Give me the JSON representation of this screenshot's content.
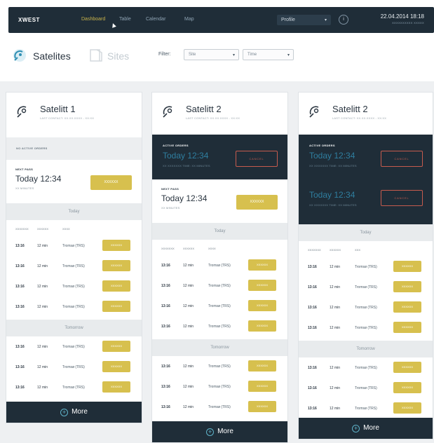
{
  "topbar": {
    "brand": "XWEST",
    "nav": [
      "Dashboard",
      "Table",
      "Calendar",
      "Map"
    ],
    "active_nav": "Dashboard",
    "profile_label": "Profile",
    "info_label": "i",
    "datetime": "22.04.2014 18:18",
    "datetime_sub": "XXXXXXXXXX XXXXX"
  },
  "header": {
    "satellites_label": "Satelites",
    "sites_label": "Sites",
    "filter_label": "Filter:",
    "filter_site": "Site",
    "filter_time": "Time"
  },
  "columns": [
    {
      "title": "Satelitt 1",
      "subtitle": "LAST CONTACT: XX.XX.XXXX - XX:XX",
      "no_orders_text": "NO ACTIVE ORDERS",
      "next_pass": {
        "label": "NEXT PASS",
        "time": "Today 12:34",
        "sub": "XX MINUTES",
        "button": "XXXXXX"
      },
      "sections": [
        {
          "name": "Today",
          "headers": [
            "XXXXXXX",
            "XXXXXX",
            "XXXX"
          ],
          "rows": [
            {
              "time": "13:16",
              "dur": "12 min",
              "site": "Tromsø (TRS)",
              "btn": "XXXXXX"
            },
            {
              "time": "13:16",
              "dur": "12 min",
              "site": "Tromsø (TRS)",
              "btn": "XXXXXX"
            },
            {
              "time": "13:16",
              "dur": "12 min",
              "site": "Tromsø (TRS)",
              "btn": "XXXXXX"
            },
            {
              "time": "13:16",
              "dur": "12 min",
              "site": "Tromsø (TRS)",
              "btn": "XXXXXX"
            }
          ]
        },
        {
          "name": "Tomorrow",
          "rows": [
            {
              "time": "13:16",
              "dur": "12 min",
              "site": "Tromsø (TRS)",
              "btn": "XXXXXX"
            },
            {
              "time": "13:16",
              "dur": "12 min",
              "site": "Tromsø (TRS)",
              "btn": "XXXXXX"
            },
            {
              "time": "13:16",
              "dur": "12 min",
              "site": "Tromsø (TRS)",
              "btn": "XXXXXX"
            }
          ]
        }
      ],
      "more": "More"
    },
    {
      "title": "Satelitt 2",
      "subtitle": "LAST CONTACT: XX.XX.XXXX - XX:XX",
      "active_orders": [
        {
          "label": "ACTIVE ORDERS",
          "time": "Today 12:34",
          "sub": "XX XXXXXXX TIME: XX MINUTES",
          "button": "CANCEL"
        }
      ],
      "next_pass": {
        "label": "NEXT PASS",
        "time": "Today 12:34",
        "sub": "XX MINUTES",
        "button": "XXXXXX"
      },
      "sections": [
        {
          "name": "Today",
          "headers": [
            "XXXXXXX",
            "XXXXXX",
            "XXXX"
          ],
          "rows": [
            {
              "time": "13:16",
              "dur": "12 min",
              "site": "Tromsø (TRS)",
              "btn": "XXXXXX"
            },
            {
              "time": "13:16",
              "dur": "12 min",
              "site": "Tromsø (TRS)",
              "btn": "XXXXXX"
            },
            {
              "time": "13:16",
              "dur": "12 min",
              "site": "Tromsø (TRS)",
              "btn": "XXXXXX"
            },
            {
              "time": "13:16",
              "dur": "12 min",
              "site": "Tromsø (TRS)",
              "btn": "XXXXXX"
            }
          ]
        },
        {
          "name": "Tomorrow",
          "rows": [
            {
              "time": "13:16",
              "dur": "12 min",
              "site": "Tromsø (TRS)",
              "btn": "XXXXXX"
            },
            {
              "time": "13:16",
              "dur": "12 min",
              "site": "Tromsø (TRS)",
              "btn": "XXXXXX"
            },
            {
              "time": "13:16",
              "dur": "12 min",
              "site": "Tromsø (TRS)",
              "btn": "XXXXXX"
            }
          ]
        }
      ],
      "more": "More"
    },
    {
      "title": "Satelitt 2",
      "subtitle": "LAST CONTACT: XX.XX.XXXX - XX:XX",
      "active_orders": [
        {
          "label": "ACTIVE ORDERS",
          "time": "Today 12:34",
          "sub": "XX XXXXXXX TIME: XX MINUTES",
          "button": "CANCEL"
        },
        {
          "label": "",
          "time": "Today 12:34",
          "sub": "XX XXXXXXX TIME: XX MINUTES",
          "button": "CANCEL"
        }
      ],
      "sections": [
        {
          "name": "Today",
          "headers": [
            "XXXXXXX",
            "XXXXXX",
            "XXX"
          ],
          "rows": [
            {
              "time": "13:16",
              "dur": "12 min",
              "site": "Tromsø (TRS)",
              "btn": "XXXXXX"
            },
            {
              "time": "13:16",
              "dur": "12 min",
              "site": "Tromsø (TRS)",
              "btn": "XXXXXX"
            },
            {
              "time": "13:16",
              "dur": "12 min",
              "site": "Tromsø (TRS)",
              "btn": "XXXXXX"
            },
            {
              "time": "13:16",
              "dur": "12 min",
              "site": "Tromsø (TRS)",
              "btn": "XXXXXX"
            }
          ]
        },
        {
          "name": "Tomorrow",
          "rows": [
            {
              "time": "13:16",
              "dur": "12 min",
              "site": "Tromsø (TRS)",
              "btn": "XXXXXX"
            },
            {
              "time": "13:16",
              "dur": "12 min",
              "site": "Tromsø (TRS)",
              "btn": "XXXXXX"
            },
            {
              "time": "13:16",
              "dur": "12 min",
              "site": "Tromsø (TRS)",
              "btn": "XXXXXX"
            }
          ]
        }
      ],
      "more": "More"
    }
  ],
  "colors": {
    "navy": "#1f2d38",
    "gold": "#d7c04e",
    "cancel": "#c65b4e",
    "accent_blue": "#2f7e9f"
  }
}
